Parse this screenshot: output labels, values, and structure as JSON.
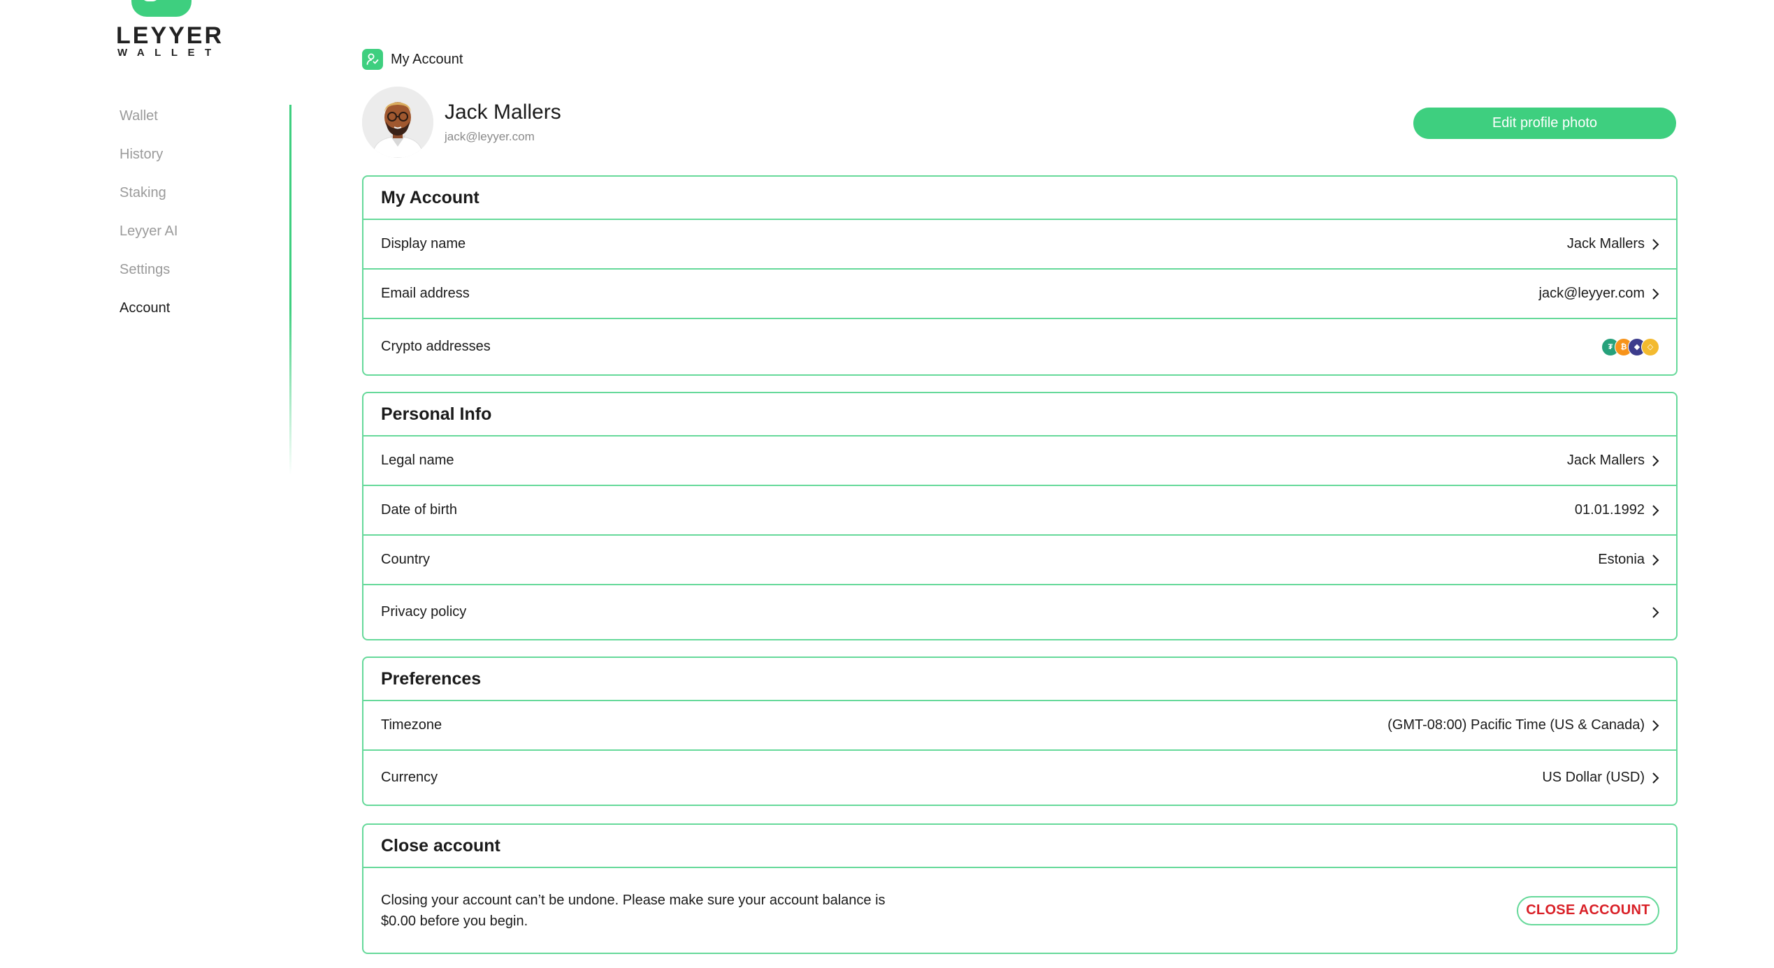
{
  "brand": {
    "name": "LEYYER",
    "sub": "WALLET",
    "accent": "#3ecf7f"
  },
  "sidebar": {
    "items": [
      {
        "label": "Wallet",
        "active": false
      },
      {
        "label": "History",
        "active": false
      },
      {
        "label": "Staking",
        "active": false
      },
      {
        "label": "Leyyer AI",
        "active": false
      },
      {
        "label": "Settings",
        "active": false
      },
      {
        "label": "Account",
        "active": true
      }
    ]
  },
  "header": {
    "breadcrumb": "My Account",
    "breadcrumb_icon": "user-icon",
    "user_name": "Jack Mallers",
    "user_email": "jack@leyyer.com",
    "edit_photo_label": "Edit profile photo"
  },
  "my_account": {
    "title": "My Account",
    "rows": [
      {
        "label": "Display name",
        "value": "Jack Mallers"
      },
      {
        "label": "Email address",
        "value": "jack@leyyer.com"
      },
      {
        "label": "Crypto addresses",
        "value": "",
        "coins": [
          "tether-icon",
          "bitcoin-icon",
          "ethereum-icon",
          "bnb-icon"
        ]
      }
    ]
  },
  "personal_info": {
    "title": "Personal Info",
    "rows": [
      {
        "label": "Legal name",
        "value": "Jack Mallers"
      },
      {
        "label": "Date of birth",
        "value": "01.01.1992"
      },
      {
        "label": "Country",
        "value": "Estonia"
      },
      {
        "label": "Privacy policy",
        "value": ""
      }
    ]
  },
  "preferences": {
    "title": "Preferences",
    "rows": [
      {
        "label": "Timezone",
        "value": "(GMT-08:00) Pacific Time (US & Canada)"
      },
      {
        "label": "Currency",
        "value": "US Dollar (USD)"
      }
    ]
  },
  "close_account": {
    "title": "Close account",
    "text": "Closing your account can’t be undone. Please make sure your account balance is $0.00 before you begin.",
    "button_label": "CLOSE ACCOUNT",
    "button_color": "#d92027"
  }
}
